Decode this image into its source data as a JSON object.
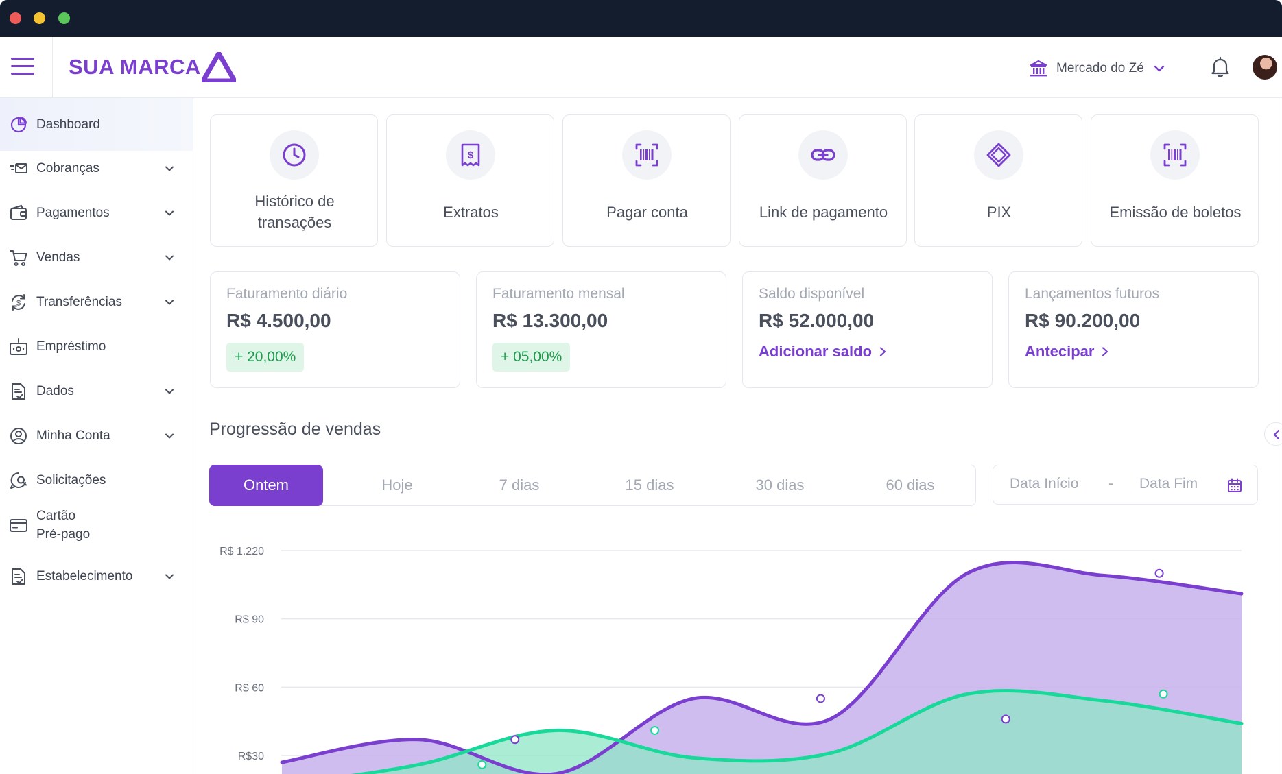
{
  "brand": {
    "name": "SUA MARCA",
    "logo_icon": "triangle-logo-icon",
    "accent": "#7a3fcf"
  },
  "header": {
    "menu_icon": "hamburger-menu-icon",
    "org_icon": "bank-icon",
    "org_name": "Mercado do Zé",
    "notification_icon": "bell-icon"
  },
  "sidebar": {
    "items": [
      {
        "label": "Dashboard",
        "icon": "pie-chart-icon",
        "active": true,
        "expandable": false
      },
      {
        "label": "Cobranças",
        "icon": "fast-mail-icon",
        "active": false,
        "expandable": true
      },
      {
        "label": "Pagamentos",
        "icon": "wallet-icon",
        "active": false,
        "expandable": true
      },
      {
        "label": "Vendas",
        "icon": "cart-icon",
        "active": false,
        "expandable": true
      },
      {
        "label": "Transferências",
        "icon": "transfer-cycle-icon",
        "active": false,
        "expandable": true
      },
      {
        "label": "Empréstimo",
        "icon": "money-box-icon",
        "active": false,
        "expandable": false
      },
      {
        "label": "Dados",
        "icon": "document-check-icon",
        "active": false,
        "expandable": true
      },
      {
        "label": "Minha Conta",
        "icon": "user-circle-icon",
        "active": false,
        "expandable": true
      },
      {
        "label": "Solicitações",
        "icon": "chat-search-icon",
        "active": false,
        "expandable": false
      },
      {
        "label": "Cartão\nPré-pago",
        "icon": "card-icon",
        "active": false,
        "expandable": false
      },
      {
        "label": "Estabelecimento",
        "icon": "document-check-icon",
        "active": false,
        "expandable": true
      }
    ]
  },
  "quick_actions": [
    {
      "label": "Histórico de transações",
      "icon": "clock-icon"
    },
    {
      "label": "Extratos",
      "icon": "receipt-icon"
    },
    {
      "label": "Pagar conta",
      "icon": "barcode-scan-icon"
    },
    {
      "label": "Link de pagamento",
      "icon": "link-icon"
    },
    {
      "label": "PIX",
      "icon": "pix-icon"
    },
    {
      "label": "Emissão de boletos",
      "icon": "barcode-scan-icon"
    }
  ],
  "stats": [
    {
      "title": "Faturamento diário",
      "value": "R$ 4.500,00",
      "badge": "+ 20,00%"
    },
    {
      "title": "Faturamento mensal",
      "value": "R$ 13.300,00",
      "badge": "+ 05,00%"
    },
    {
      "title": "Saldo disponível",
      "value": "R$ 52.000,00",
      "link": "Adicionar saldo"
    },
    {
      "title": "Lançamentos futuros",
      "value": "R$ 90.200,00",
      "link": "Antecipar"
    }
  ],
  "sales": {
    "title": "Progressão de vendas",
    "ranges": [
      "Ontem",
      "Hoje",
      "7 dias",
      "15 dias",
      "30 dias",
      "60 dias"
    ],
    "active_range": "Ontem",
    "date_start_placeholder": "Data Início",
    "date_separator": "-",
    "date_end_placeholder": "Data Fim",
    "calendar_icon": "calendar-icon"
  },
  "chart_data": {
    "type": "area",
    "title": "",
    "xlabel": "",
    "ylabel": "",
    "y_tick_labels": [
      "R$ 1.220",
      "R$ 90",
      "R$ 60",
      "R$30"
    ],
    "y_tick_values": [
      120,
      90,
      60,
      30
    ],
    "ylim": [
      20,
      120
    ],
    "x": [
      0,
      1,
      2,
      3,
      4,
      5,
      6,
      7
    ],
    "series": [
      {
        "color": "#7a3fcf",
        "fill": "#c8b2ec",
        "values": [
          27,
          37,
          22,
          55,
          46,
          110,
          109,
          101
        ]
      },
      {
        "color": "#19d99a",
        "fill": "#8fe6c6",
        "values": [
          17,
          26,
          41,
          29,
          31,
          57,
          54,
          44
        ]
      }
    ],
    "marked_points": [
      {
        "series": 0,
        "x": 1.7,
        "value": 37
      },
      {
        "series": 1,
        "x": 1.46,
        "value": 26
      },
      {
        "series": 1,
        "x": 2.72,
        "value": 41
      },
      {
        "series": 0,
        "x": 3.93,
        "value": 55
      },
      {
        "series": 0,
        "x": 5.28,
        "value": 46
      },
      {
        "series": 0,
        "x": 6.4,
        "value": 110
      },
      {
        "series": 1,
        "x": 6.43,
        "value": 57
      }
    ],
    "grid": true,
    "legend": "none"
  }
}
